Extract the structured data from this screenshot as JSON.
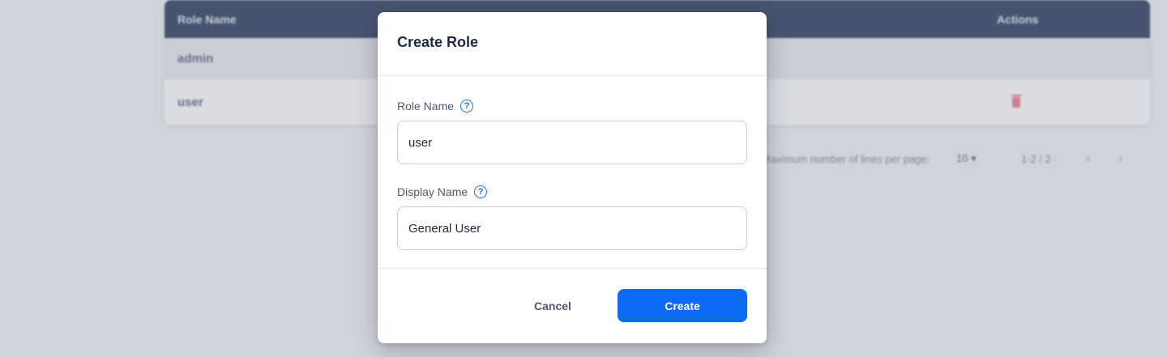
{
  "background": {
    "table": {
      "headers": {
        "role_name": "Role Name",
        "actions": "Actions"
      },
      "rows": [
        {
          "name": "admin"
        },
        {
          "name": "user"
        }
      ]
    },
    "pagination": {
      "lines_label": "Maximum number of lines per page:",
      "per_page": "10 ▾",
      "range": "1-2 / 2",
      "prev": "‹",
      "next": "›"
    }
  },
  "modal": {
    "title": "Create Role",
    "fields": {
      "role_name": {
        "label": "Role Name",
        "value": "user"
      },
      "display_name": {
        "label": "Display Name",
        "value": "General User"
      }
    },
    "cancel_label": "Cancel",
    "create_label": "Create"
  },
  "colors": {
    "header_bg": "#1f2f52",
    "primary": "#0b6bf6",
    "help_icon": "#1a73e8",
    "delete_icon": "#d2697c"
  },
  "icons": {
    "help": "question-circle-icon",
    "delete": "trash-icon"
  }
}
